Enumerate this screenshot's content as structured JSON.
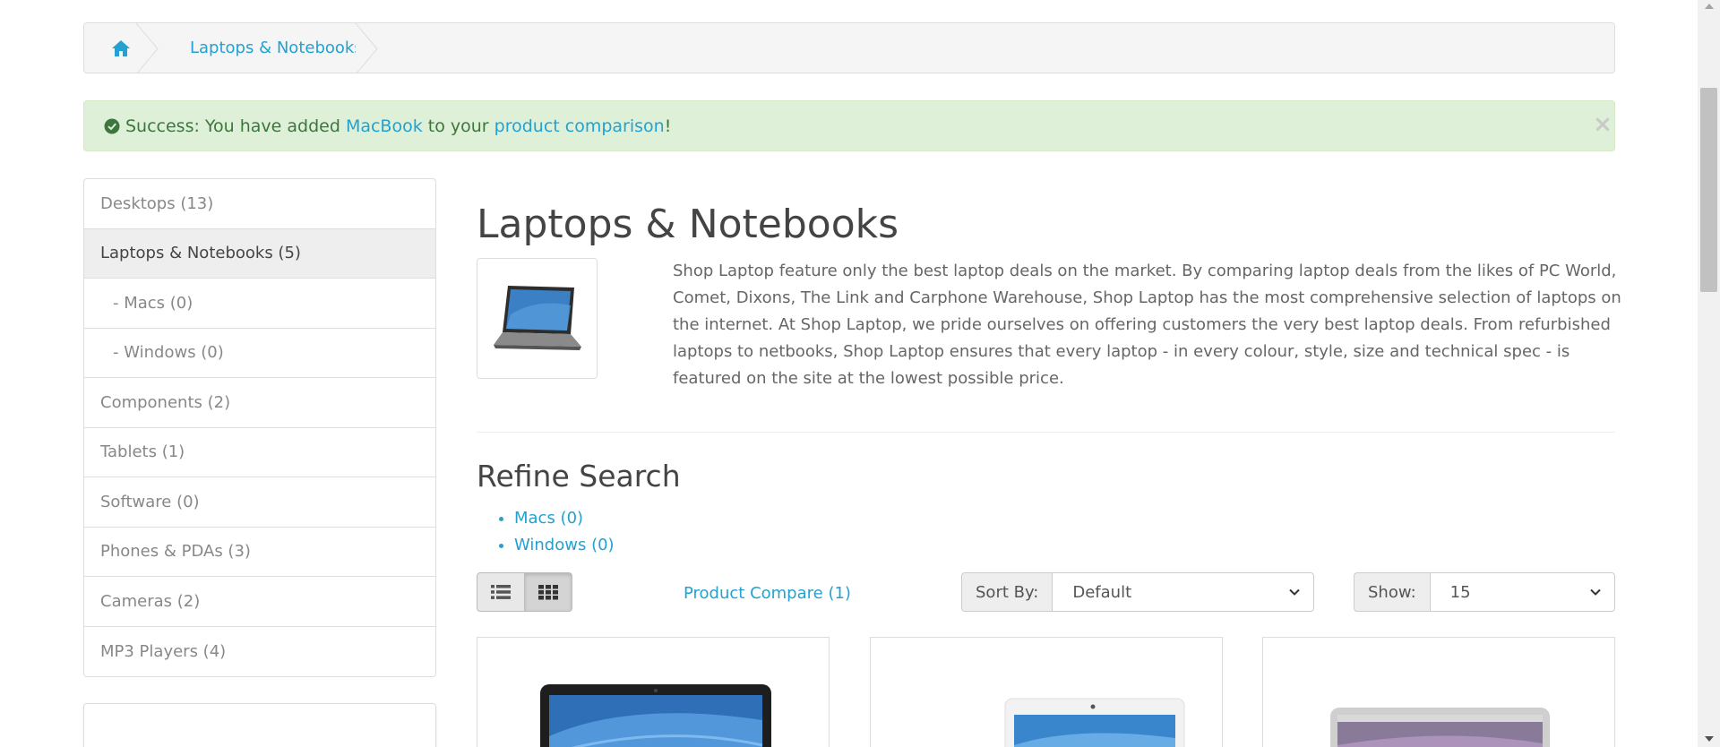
{
  "breadcrumb": {
    "home_icon": "home-icon",
    "items": [
      "Laptops & Notebooks"
    ]
  },
  "alert": {
    "icon": "check-circle-icon",
    "prefix": "Success: You have added ",
    "product_link": "MacBook",
    "middle": " to your ",
    "compare_link": "product comparison",
    "suffix": "!",
    "close": "×",
    "bg_color": "#dff0d8",
    "text_color": "#3c763d"
  },
  "sidebar": {
    "items": [
      {
        "label": "Desktops (13)"
      },
      {
        "label": "Laptops & Notebooks (5)"
      },
      {
        "label": "- Macs (0)"
      },
      {
        "label": "- Windows (0)"
      },
      {
        "label": "Components (2)"
      },
      {
        "label": "Tablets (1)"
      },
      {
        "label": "Software (0)"
      },
      {
        "label": "Phones & PDAs (3)"
      },
      {
        "label": "Cameras (2)"
      },
      {
        "label": "MP3 Players (4)"
      }
    ]
  },
  "main": {
    "title": "Laptops & Notebooks",
    "description": "Shop Laptop feature only the best laptop deals on the market. By comparing laptop deals from the likes of PC World, Comet, Dixons, The Link and Carphone Warehouse, Shop Laptop has the most comprehensive selection of laptops on the internet. At Shop Laptop, we pride ourselves on offering customers the very best laptop deals. From refurbished laptops to netbooks, Shop Laptop ensures that every laptop - in every colour, style, size and technical spec - is featured on the site at the lowest possible price.",
    "refine_title": "Refine Search",
    "refine_items": [
      "Macs (0)",
      "Windows (0)"
    ]
  },
  "toolbar": {
    "list_view_icon": "list-view-icon",
    "grid_view_icon": "grid-view-icon",
    "compare_label": "Product Compare (1)",
    "sort_label": "Sort By:",
    "sort_value": "Default",
    "show_label": "Show:",
    "show_value": "15"
  },
  "colors": {
    "link": "#23a1d1",
    "border": "#dddddd"
  }
}
